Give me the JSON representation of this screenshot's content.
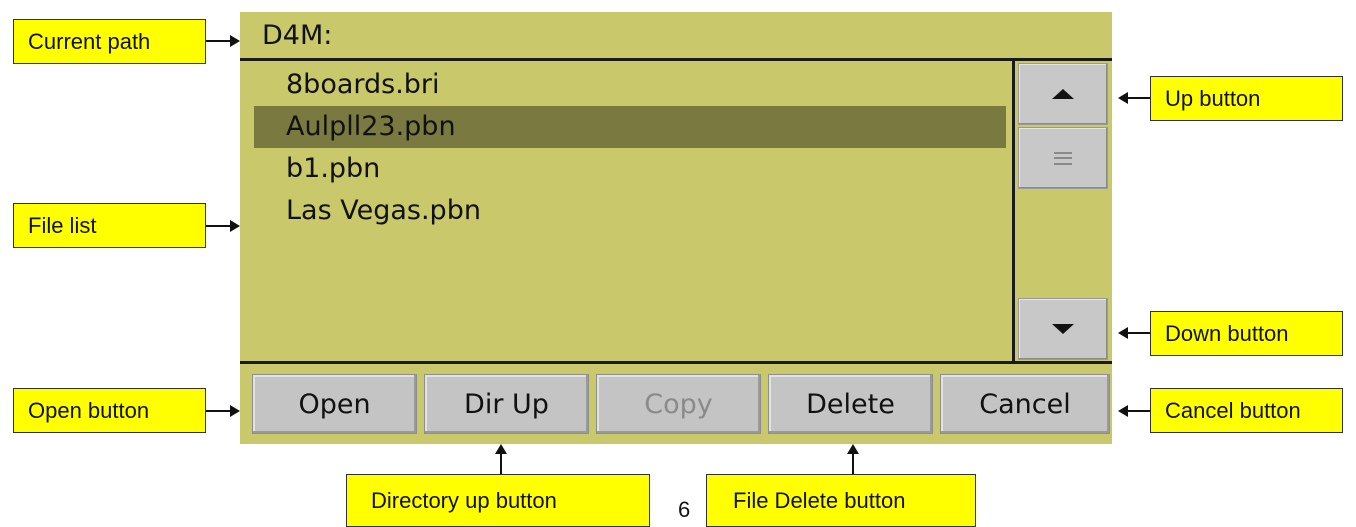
{
  "screen": {
    "path": "D4M:",
    "files": [
      "8boards.bri",
      "Aulpll23.pbn",
      "b1.pbn",
      "Las Vegas.pbn"
    ],
    "selected_index": 1,
    "actions": [
      {
        "label": "Open",
        "enabled": true
      },
      {
        "label": "Dir Up",
        "enabled": true
      },
      {
        "label": "Copy",
        "enabled": false
      },
      {
        "label": "Delete",
        "enabled": true
      },
      {
        "label": "Cancel",
        "enabled": true
      }
    ],
    "icons": {
      "up": "triangle-up-icon",
      "down": "triangle-down-icon",
      "thumb": "grip-lines-icon"
    }
  },
  "callouts": {
    "current_path": "Current path",
    "file_list": "File list",
    "open_button": "Open button",
    "up_button": "Up button",
    "down_button": "Down button",
    "cancel_button": "Cancel button",
    "directory_up_button": "Directory up button",
    "file_delete_button": "File Delete button"
  },
  "page_number": "6",
  "colors": {
    "screen_bg": "#c9c86a",
    "selection_bg": "#7a7a40",
    "callout_bg": "#ffff00"
  }
}
